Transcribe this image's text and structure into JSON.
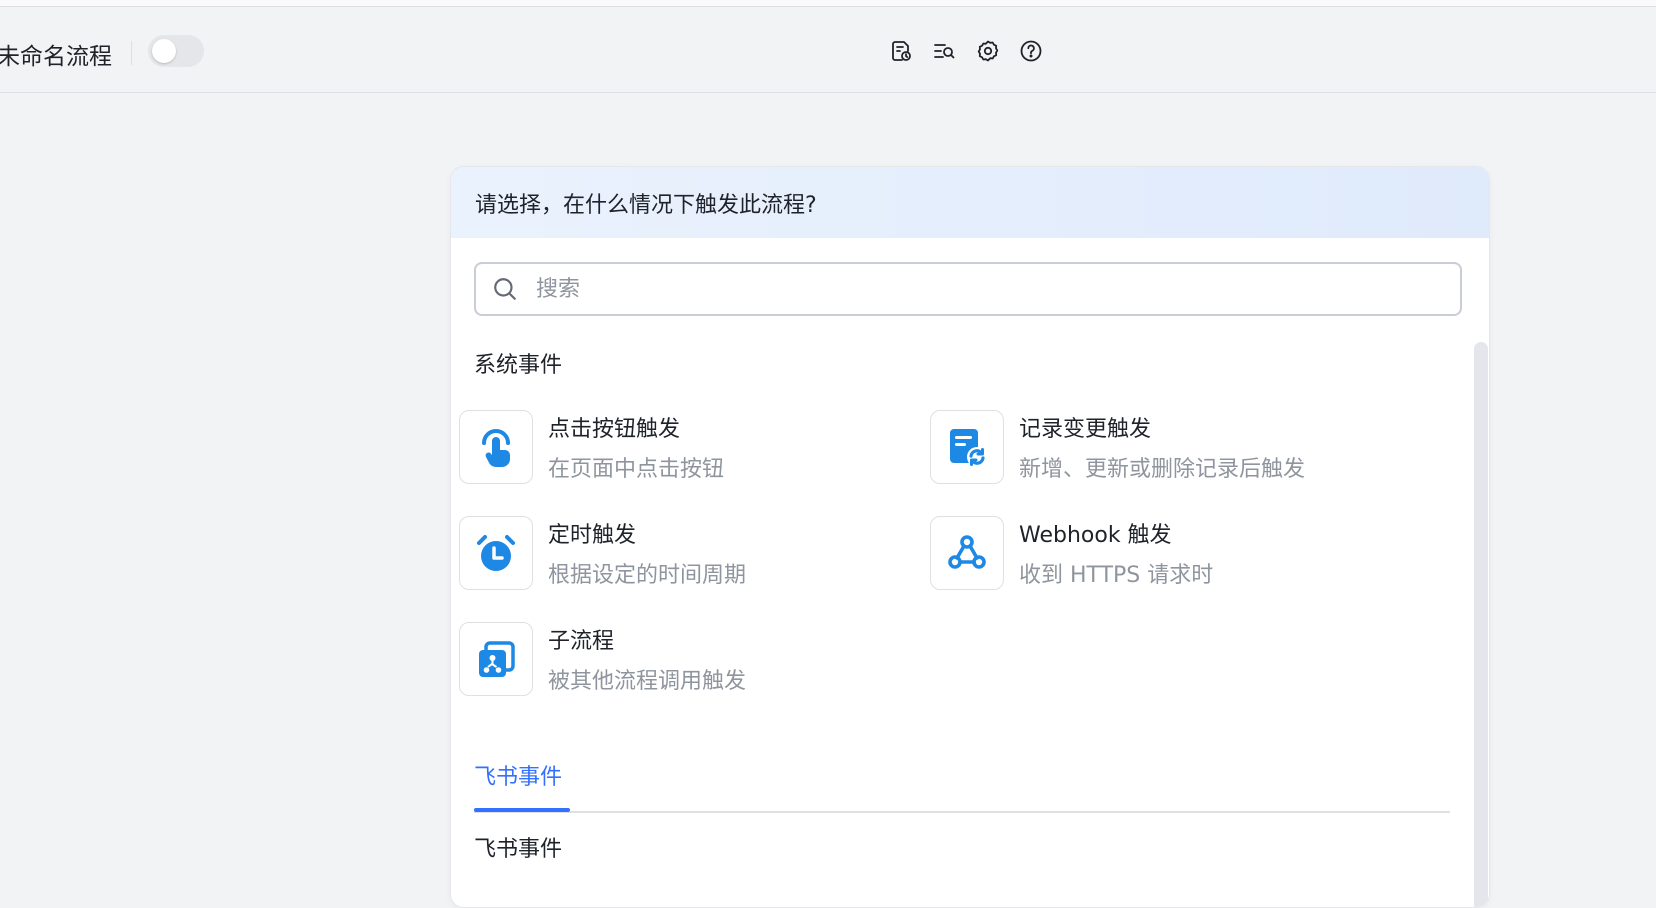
{
  "toolbar": {
    "flow_name": "未命名流程",
    "icons": [
      "run-log-icon",
      "search-list-icon",
      "gear-icon",
      "help-icon"
    ]
  },
  "panel": {
    "header": "请选择，在什么情况下触发此流程?",
    "search_placeholder": "搜索",
    "system_section": "系统事件",
    "items": [
      {
        "name": "点击按钮触发",
        "desc": "在页面中点击按钮",
        "icon": "tap-finger-icon"
      },
      {
        "name": "记录变更触发",
        "desc": "新增、更新或删除记录后触发",
        "icon": "record-change-icon"
      },
      {
        "name": "定时触发",
        "desc": "根据设定的时间周期",
        "icon": "alarm-clock-icon"
      },
      {
        "name": "Webhook 触发",
        "desc": "收到 HTTPS 请求时",
        "icon": "webhook-icon"
      },
      {
        "name": "子流程",
        "desc": "被其他流程调用触发",
        "icon": "subflow-icon"
      }
    ],
    "tab_label": "飞书事件",
    "feishu_section": "飞书事件"
  },
  "colors": {
    "accent": "#3370ff",
    "icon_blue": "#1e88e5",
    "header_bg": "#e3edfc"
  }
}
